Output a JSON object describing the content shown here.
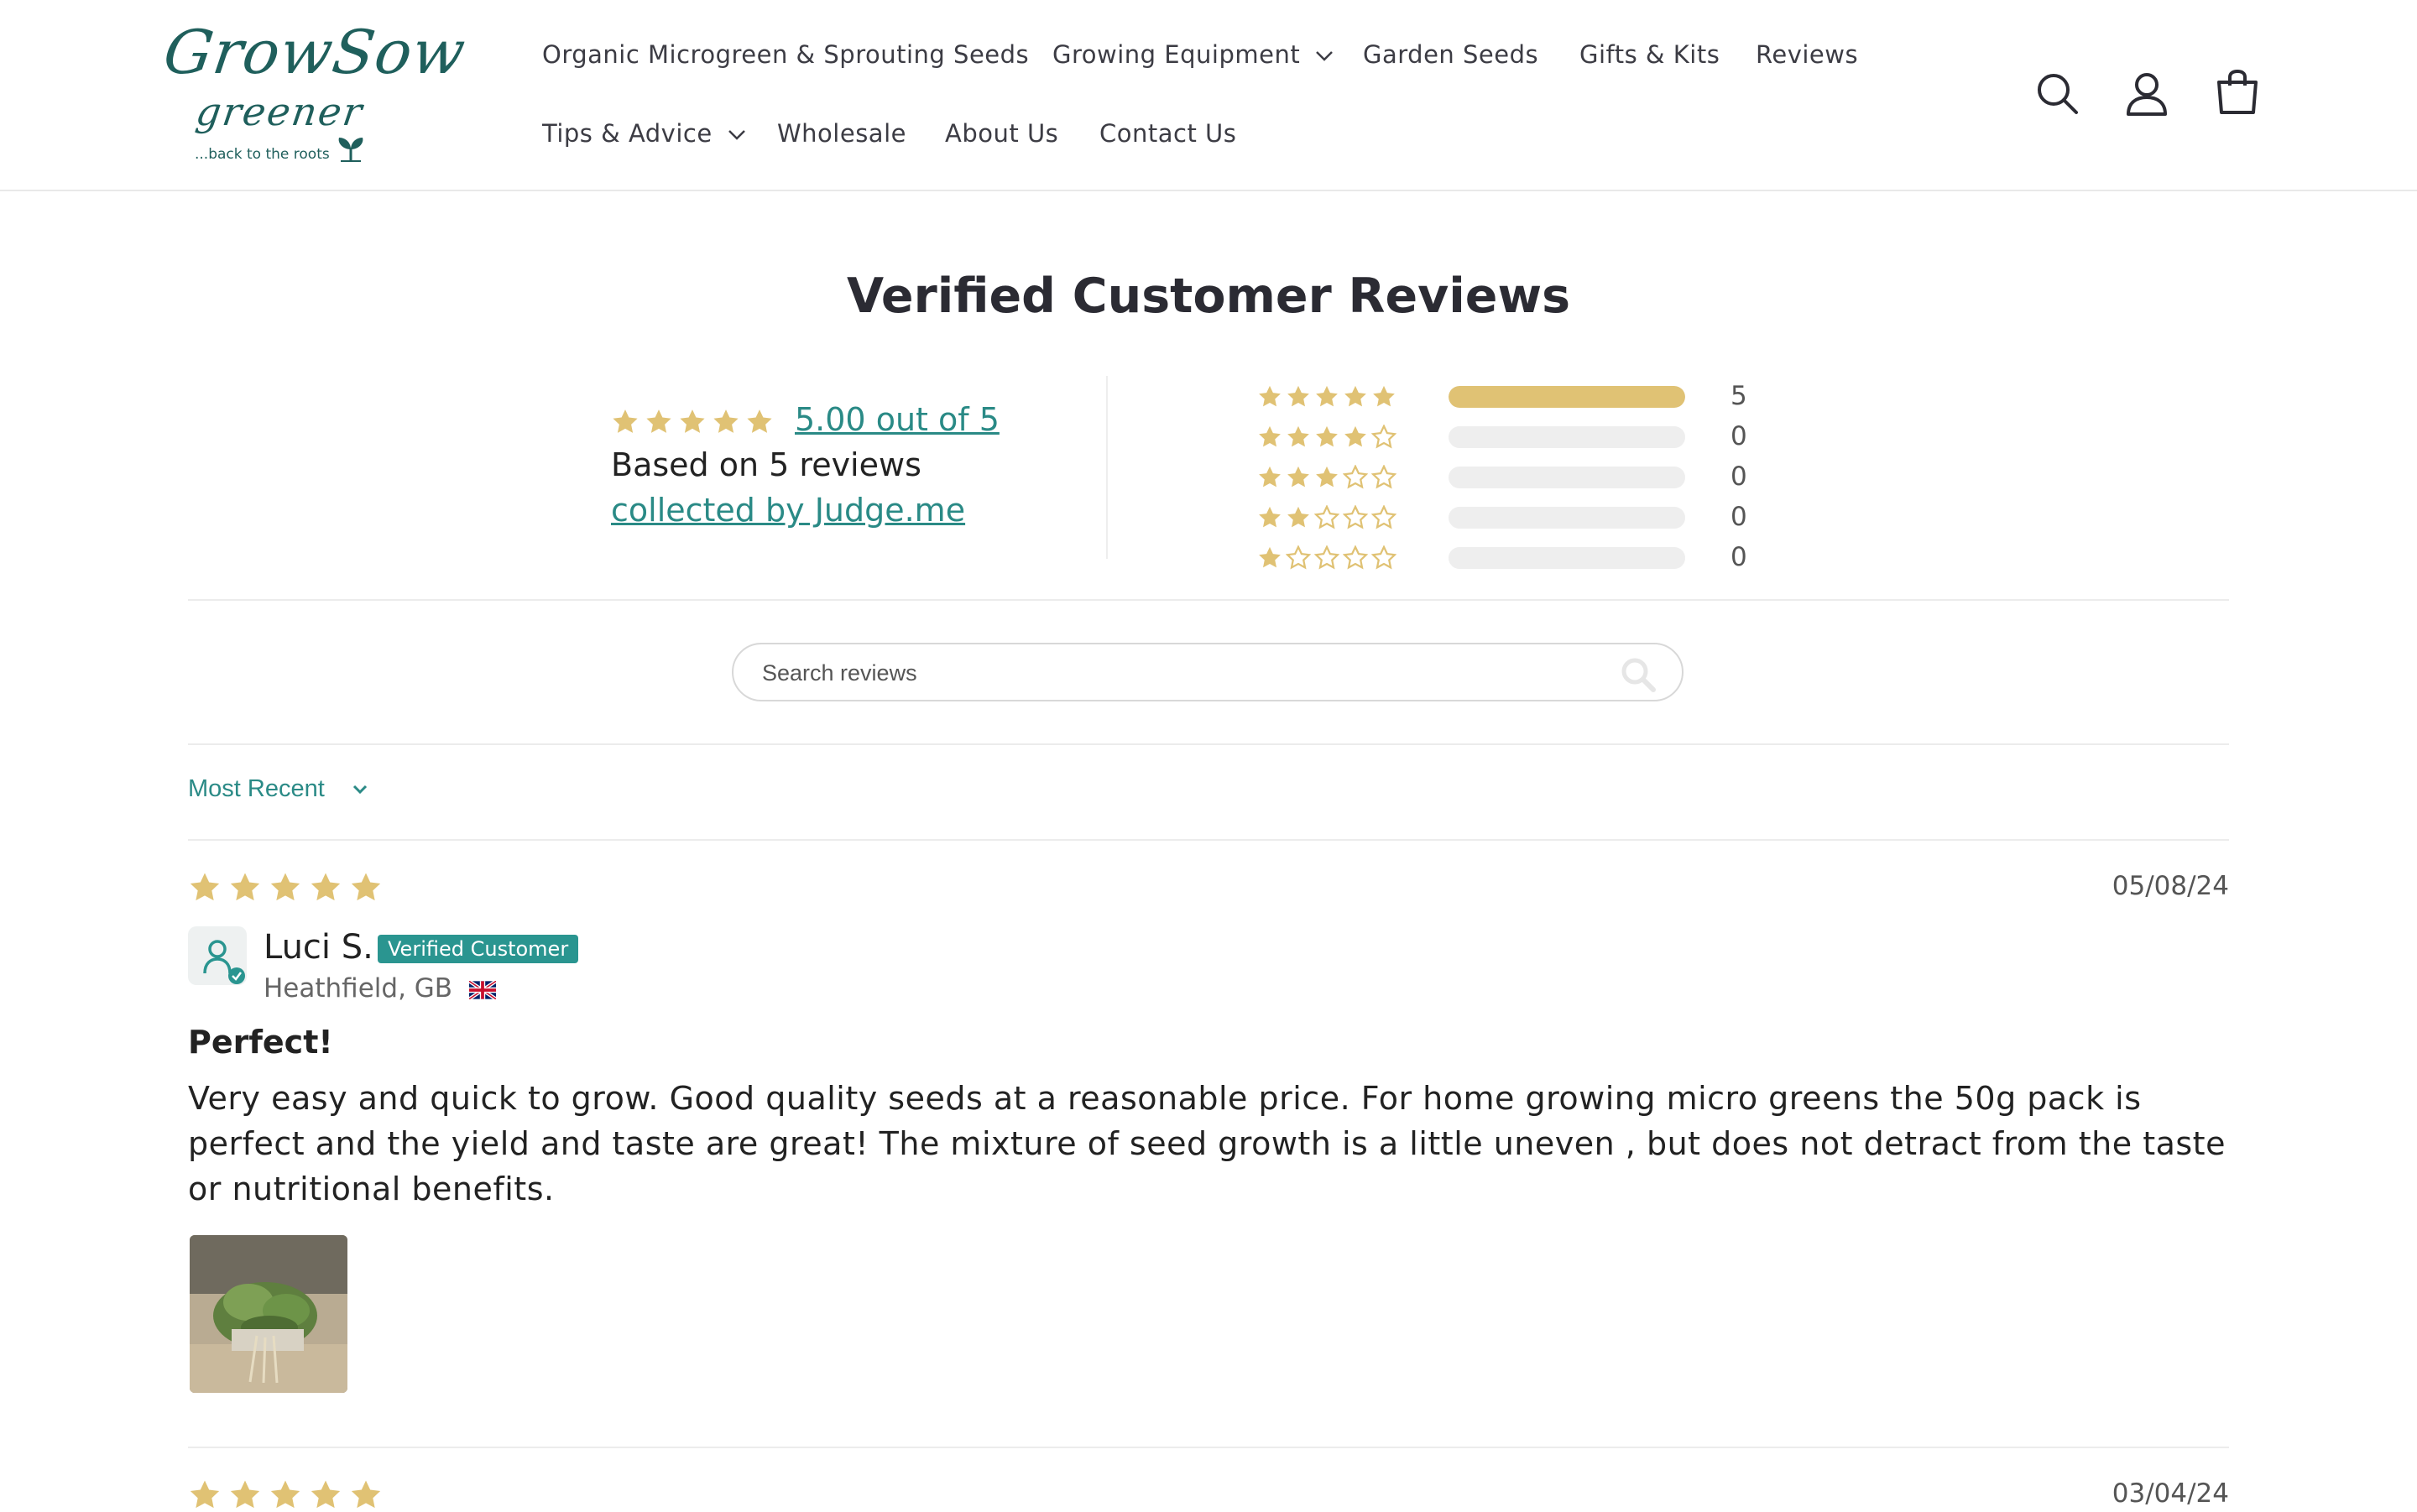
{
  "brand": {
    "logo_line1": "GrowSow",
    "logo_line2": "greener",
    "logo_tagline": "...back to the roots",
    "brand_color": "#1f5f5c",
    "accent_color": "#2a8a86",
    "star_color": "#e0c274"
  },
  "nav": {
    "items": [
      {
        "label": "Organic Microgreen & Sprouting Seeds",
        "has_dropdown": false
      },
      {
        "label": "Growing Equipment",
        "has_dropdown": true
      },
      {
        "label": "Garden Seeds",
        "has_dropdown": false
      },
      {
        "label": "Gifts & Kits",
        "has_dropdown": false
      },
      {
        "label": "Reviews",
        "has_dropdown": false
      },
      {
        "label": "Tips & Advice",
        "has_dropdown": true
      },
      {
        "label": "Wholesale",
        "has_dropdown": false
      },
      {
        "label": "About Us",
        "has_dropdown": false
      },
      {
        "label": "Contact Us",
        "has_dropdown": false
      }
    ],
    "icons": [
      "search-icon",
      "account-icon",
      "cart-icon"
    ]
  },
  "reviews": {
    "title": "Verified Customer Reviews",
    "summary": {
      "average_rating": 5,
      "average_label": "5.00 out of 5",
      "based_on": "Based on 5 reviews",
      "collected_by": "collected by Judge.me"
    },
    "histogram": [
      {
        "stars": 5,
        "count": "5",
        "fraction": 1.0
      },
      {
        "stars": 4,
        "count": "0",
        "fraction": 0
      },
      {
        "stars": 3,
        "count": "0",
        "fraction": 0
      },
      {
        "stars": 2,
        "count": "0",
        "fraction": 0
      },
      {
        "stars": 1,
        "count": "0",
        "fraction": 0
      }
    ],
    "search_placeholder": "Search reviews",
    "sort_label": "Most Recent",
    "items": [
      {
        "rating": 5,
        "date": "05/08/24",
        "author": "Luci S.",
        "badge": "Verified Customer",
        "location": "Heathfield, GB",
        "title": "Perfect!",
        "body": "Very easy and quick to grow. Good quality seeds at a reasonable price. For home growing micro greens the 50g pack is perfect and the yield and taste are great! The mixture of seed growth is a little uneven , but does not detract from the taste or nutritional benefits."
      },
      {
        "rating": 5,
        "date": "03/04/24"
      }
    ]
  }
}
